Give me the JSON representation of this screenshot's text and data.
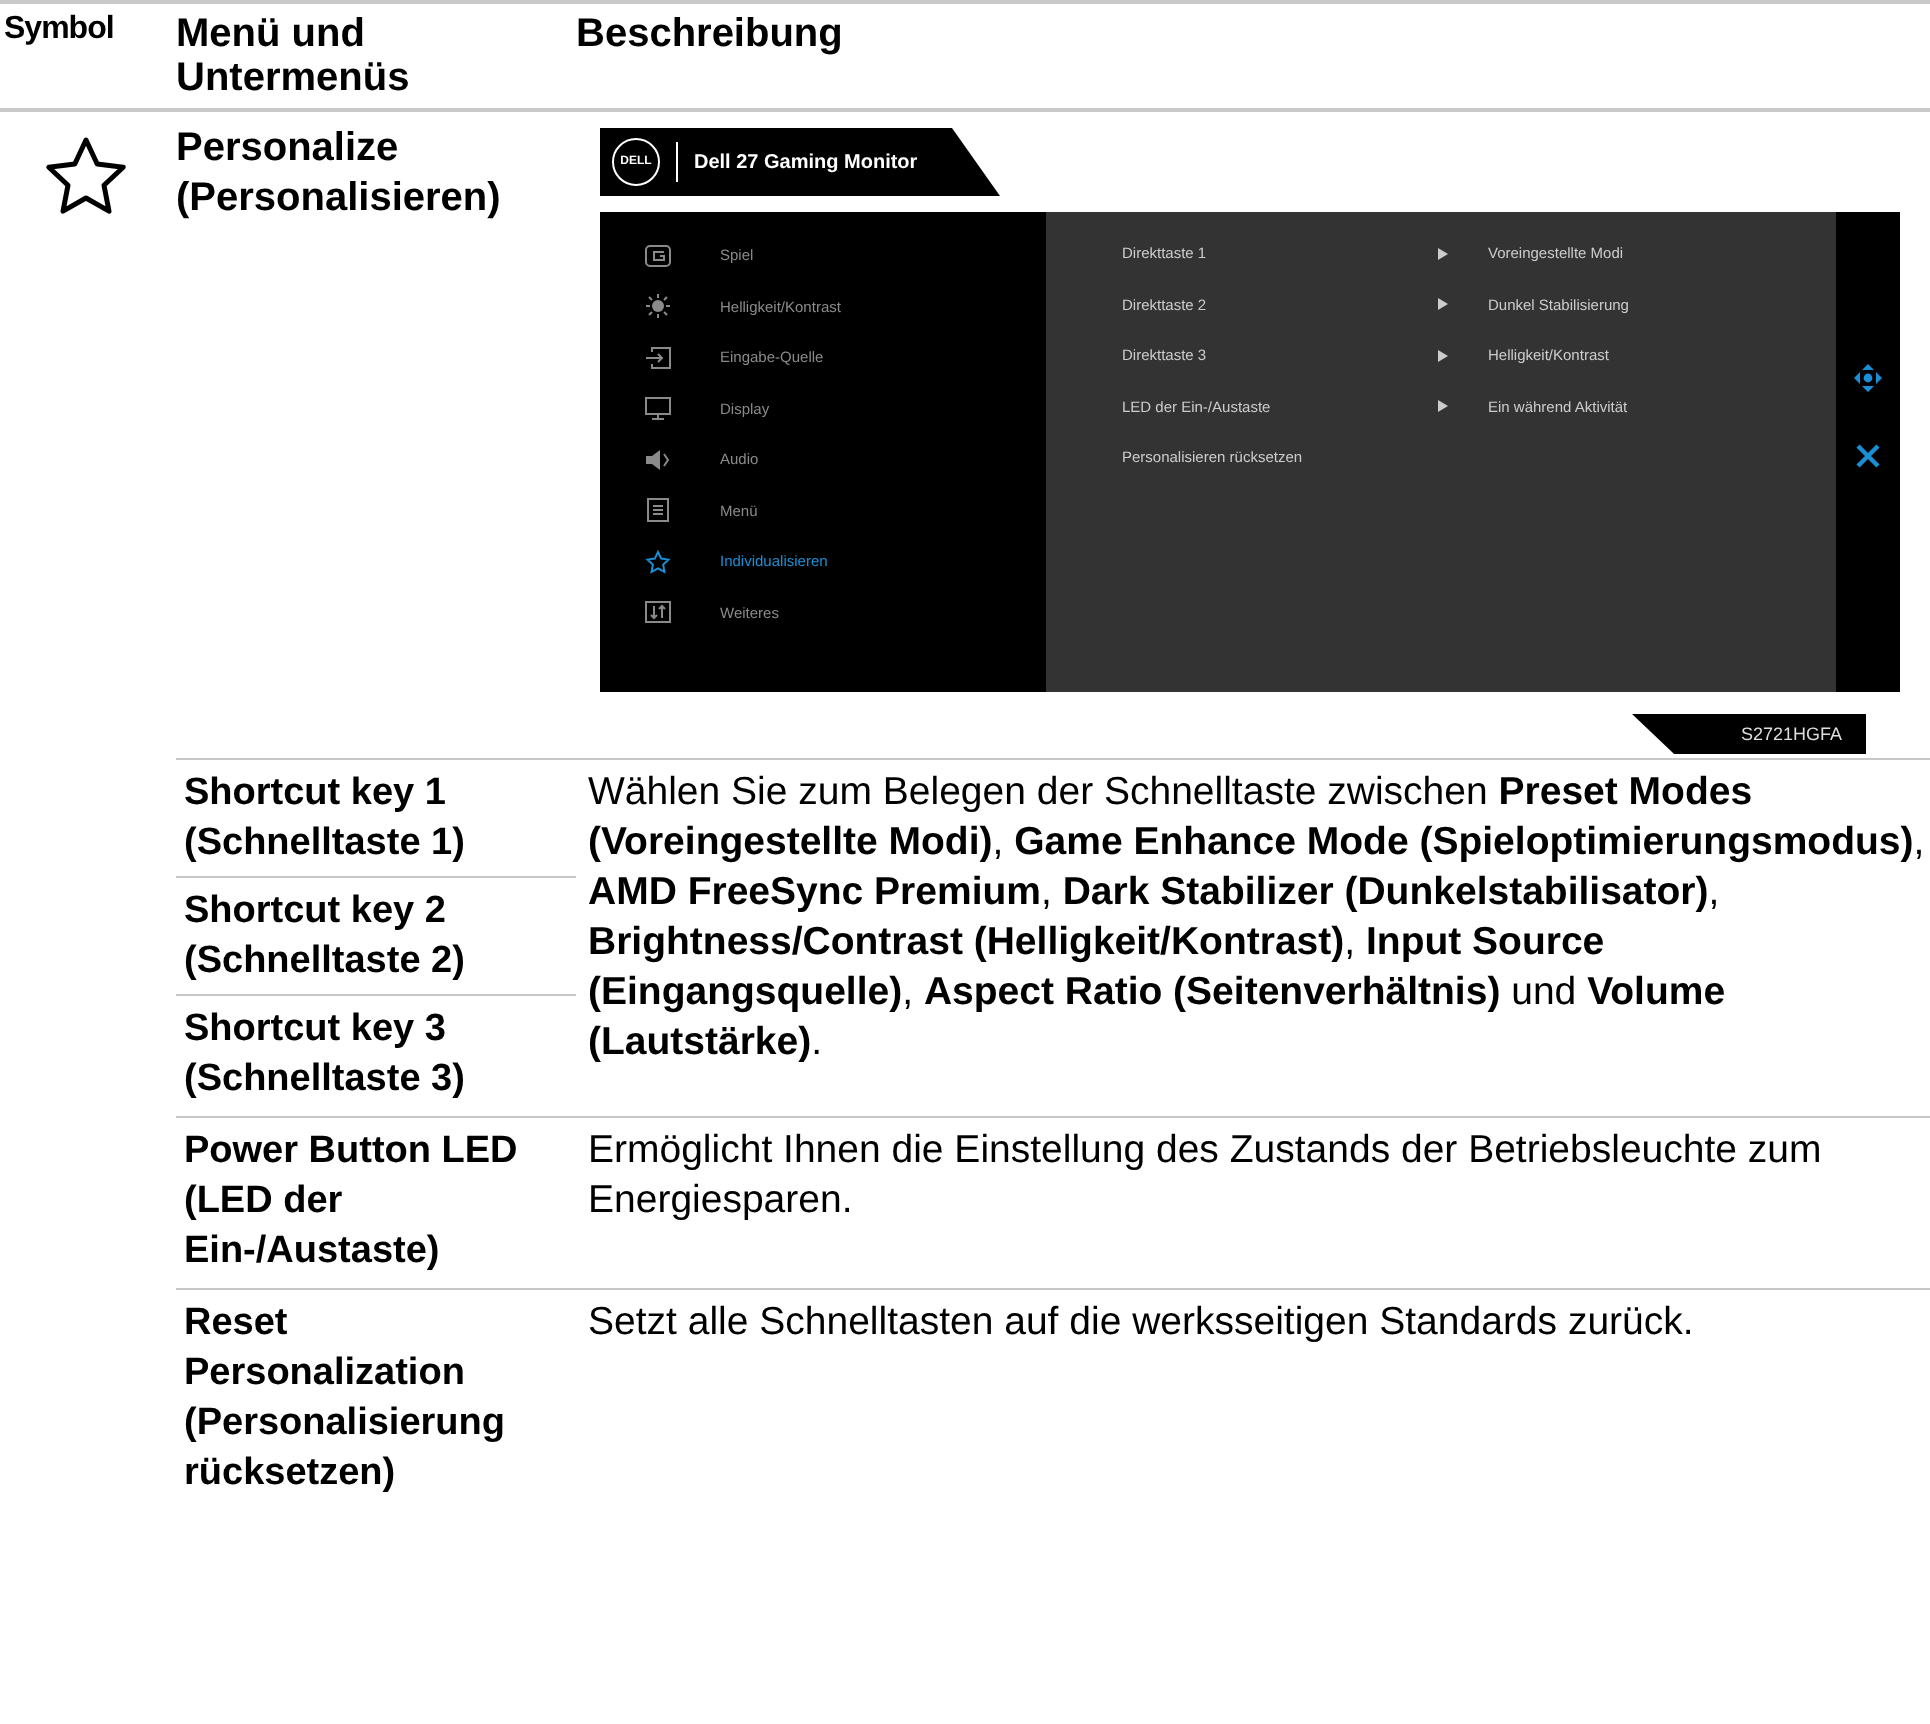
{
  "table": {
    "columns": [
      "Symbol",
      "Menü und Untermenüs",
      "Beschreibung"
    ],
    "section": {
      "title": "Personalize (Personalisieren)"
    },
    "osd": {
      "logo": "DELL",
      "title": "Dell 27 Gaming Monitor",
      "menu": [
        {
          "label": "Spiel",
          "selected": false
        },
        {
          "label": "Helligkeit/Kontrast",
          "selected": false
        },
        {
          "label": "Eingabe-Quelle",
          "selected": false
        },
        {
          "label": "Display",
          "selected": false
        },
        {
          "label": "Audio",
          "selected": false
        },
        {
          "label": "Menü",
          "selected": false
        },
        {
          "label": "Individualisieren",
          "selected": true
        },
        {
          "label": "Weiteres",
          "selected": false
        }
      ],
      "options": [
        {
          "label": "Direkttaste 1",
          "value": "Voreingestellte Modi"
        },
        {
          "label": "Direkttaste 2",
          "value": "Dunkel Stabilisierung"
        },
        {
          "label": "Direkttaste 3",
          "value": "Helligkeit/Kontrast"
        },
        {
          "label": "LED der Ein-/Austaste",
          "value": "Ein während Aktivität"
        },
        {
          "label": "Personalisieren rücksetzen"
        }
      ],
      "model": "S2721HGFA"
    },
    "rows": [
      {
        "labels": [
          "Shortcut key 1 (Schnelltaste 1)",
          "Shortcut key 2 (Schnelltaste 2)",
          "Shortcut key 3 (Schnelltaste 3)"
        ],
        "description": "Wählen Sie zum Belegen der Schnelltaste zwischen **Preset Modes (Voreingestellte Modi)**, **Game Enhance Mode (Spieloptimierungsmodus)**, **AMD FreeSync Premium**, **Dark Stabilizer (Dunkelstabilisator)**, **Brightness/Contrast (Helligkeit/Kontrast)**, **Input Source (Eingangsquelle)**, **Aspect Ratio (Seitenverhältnis)** und **Volume (Lautstärke)**."
      },
      {
        "labels": [
          "Power Button LED (LED der Ein-/Austaste)"
        ],
        "description": "Ermöglicht Ihnen die Einstellung des Zustands der Betriebsleuchte zum Energiesparen."
      },
      {
        "labels": [
          "Reset Personalization (Personalisierung rücksetzen)"
        ],
        "description": "Setzt alle Schnelltasten auf die werksseitigen Standards zurück."
      }
    ]
  }
}
